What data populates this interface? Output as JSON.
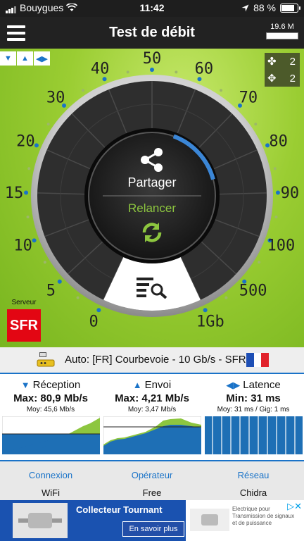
{
  "status_bar": {
    "carrier": "Bouygues",
    "time": "11:42",
    "battery": "88 %",
    "battery_level": 0.88
  },
  "app_bar": {
    "title": "Test de débit",
    "data_usage": "19.6 M"
  },
  "gauge": {
    "ticks": [
      "0",
      "5",
      "10",
      "15",
      "20",
      "30",
      "40",
      "50",
      "60",
      "70",
      "80",
      "90",
      "100",
      "500",
      "1Gb"
    ],
    "share_label": "Partager",
    "restart_label": "Relancer"
  },
  "counters": {
    "first": "2",
    "second": "2"
  },
  "server": {
    "label": "Serveur",
    "logo": "SFR"
  },
  "server_bar": {
    "text": "Auto: [FR] Courbevoie - 10 Gb/s - SFR"
  },
  "stats": {
    "reception": {
      "label": "Réception",
      "max": "Max: 80,9 Mb/s",
      "avg": "Moy: 45,6 Mb/s"
    },
    "upload": {
      "label": "Envoi",
      "max": "Max: 4,21 Mb/s",
      "avg": "Moy: 3,47 Mb/s"
    },
    "latency": {
      "label": "Latence",
      "min": "Min: 31 ms",
      "avg": "Moy: 31 ms / Gig: 1 ms"
    }
  },
  "net_info": {
    "connection": {
      "label": "Connexion",
      "value": "WiFi"
    },
    "operator": {
      "label": "Opérateur",
      "value": "Free"
    },
    "network": {
      "label": "Réseau",
      "value": "Chidra"
    }
  },
  "ad": {
    "title": "Collecteur Tournant",
    "button": "En savoir plus",
    "text": "Electrique pour Transmission de signaux et de puissance"
  },
  "colors": {
    "accent": "#1a73c8",
    "green_bg": "#9acd32",
    "relancer": "#8dc63f",
    "sfr_red": "#e30613"
  }
}
